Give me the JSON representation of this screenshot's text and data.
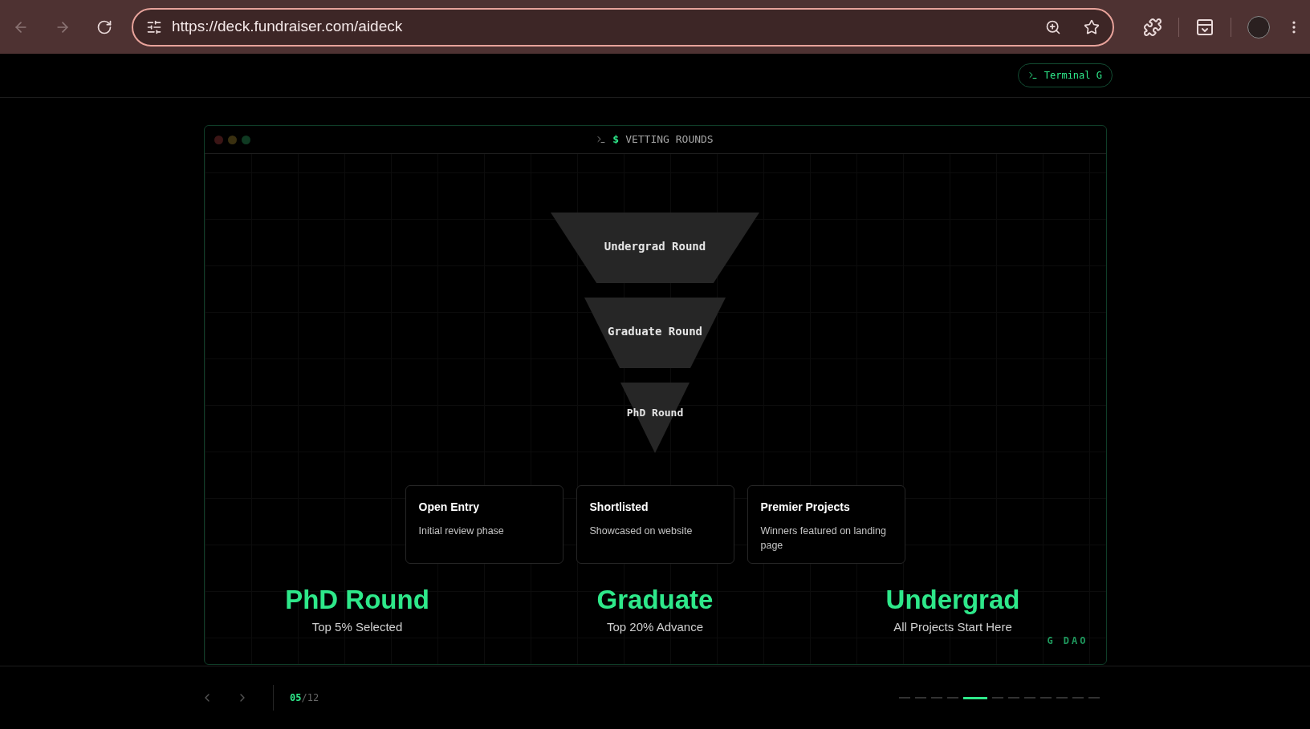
{
  "browser": {
    "url": "https://deck.fundraiser.com/aideck"
  },
  "header": {
    "badge": "Terminal G"
  },
  "slide": {
    "title_prompt": "$",
    "title": "VETTING ROUNDS",
    "funnel": [
      {
        "label": "Undergrad Round",
        "kind": "trapezoid"
      },
      {
        "label": "Graduate Round",
        "kind": "trapezoid"
      },
      {
        "label": "PhD Round",
        "kind": "triangle"
      }
    ],
    "stages": [
      {
        "title": "Open Entry",
        "description": "Initial review phase"
      },
      {
        "title": "Shortlisted",
        "description": "Showcased on website"
      },
      {
        "title": "Premier Projects",
        "description": "Winners featured on landing page"
      }
    ],
    "stats": [
      {
        "value": "PhD Round",
        "caption": "Top 5% Selected"
      },
      {
        "value": "Graduate",
        "caption": "Top 20% Advance"
      },
      {
        "value": "Undergrad",
        "caption": "All Projects Start Here"
      }
    ],
    "brand": "G DAO"
  },
  "pager": {
    "current": "05",
    "total": "/12",
    "dots": [
      {
        "selected": false
      },
      {
        "selected": false
      },
      {
        "selected": false
      },
      {
        "selected": false
      },
      {
        "selected": true
      },
      {
        "selected": false
      },
      {
        "selected": false
      },
      {
        "selected": false
      },
      {
        "selected": false
      },
      {
        "selected": false
      },
      {
        "selected": false
      },
      {
        "selected": false
      }
    ]
  }
}
